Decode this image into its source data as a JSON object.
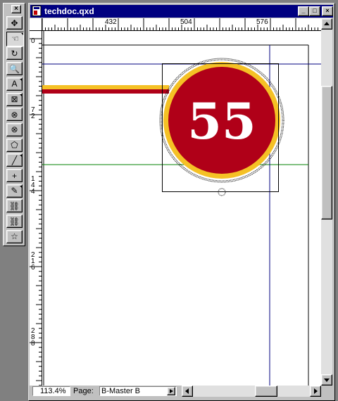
{
  "palette": {
    "close_label": "×",
    "tools": [
      {
        "name": "item-tool-icon",
        "glyph": "✥"
      },
      {
        "name": "content-tool-icon",
        "glyph": "☜"
      },
      {
        "name": "rotation-tool-icon",
        "glyph": "↻"
      },
      {
        "name": "zoom-tool-icon",
        "glyph": "🔍"
      },
      {
        "name": "text-box-tool-icon",
        "glyph": "A"
      },
      {
        "name": "picture-box-tool-icon",
        "glyph": "⊠"
      },
      {
        "name": "oval-picture-box-tool-icon",
        "glyph": "⊗"
      },
      {
        "name": "circle-picture-box-tool-icon",
        "glyph": "⊗"
      },
      {
        "name": "bezier-picture-box-tool-icon",
        "glyph": "⬠"
      },
      {
        "name": "line-tool-icon",
        "glyph": "╱"
      },
      {
        "name": "orthogonal-line-tool-icon",
        "glyph": "+"
      },
      {
        "name": "bezier-pen-tool-icon",
        "glyph": "✎"
      },
      {
        "name": "linking-tool-icon",
        "glyph": "⛓"
      },
      {
        "name": "unlinking-tool-icon",
        "glyph": "⛓"
      },
      {
        "name": "star-tool-icon",
        "glyph": "☆"
      }
    ]
  },
  "window": {
    "title": "techdoc.qxd",
    "minimize_label": "_",
    "maximize_label": "□",
    "close_label": "×"
  },
  "ruler": {
    "top_labels": [
      "432",
      "504",
      "576"
    ],
    "left_labels": [
      "0",
      "7\n2",
      "1\n4\n4",
      "2\n1\n6",
      "2\n8\n8"
    ]
  },
  "canvas": {
    "badge_number": "55",
    "colors": {
      "badge_red": "#b00018",
      "badge_gold": "#f5c125",
      "guide_blue": "#00007f",
      "guide_green": "#008000"
    }
  },
  "status": {
    "zoom": "113.4%",
    "page_label": "Page:",
    "page_value": "B-Master B"
  }
}
